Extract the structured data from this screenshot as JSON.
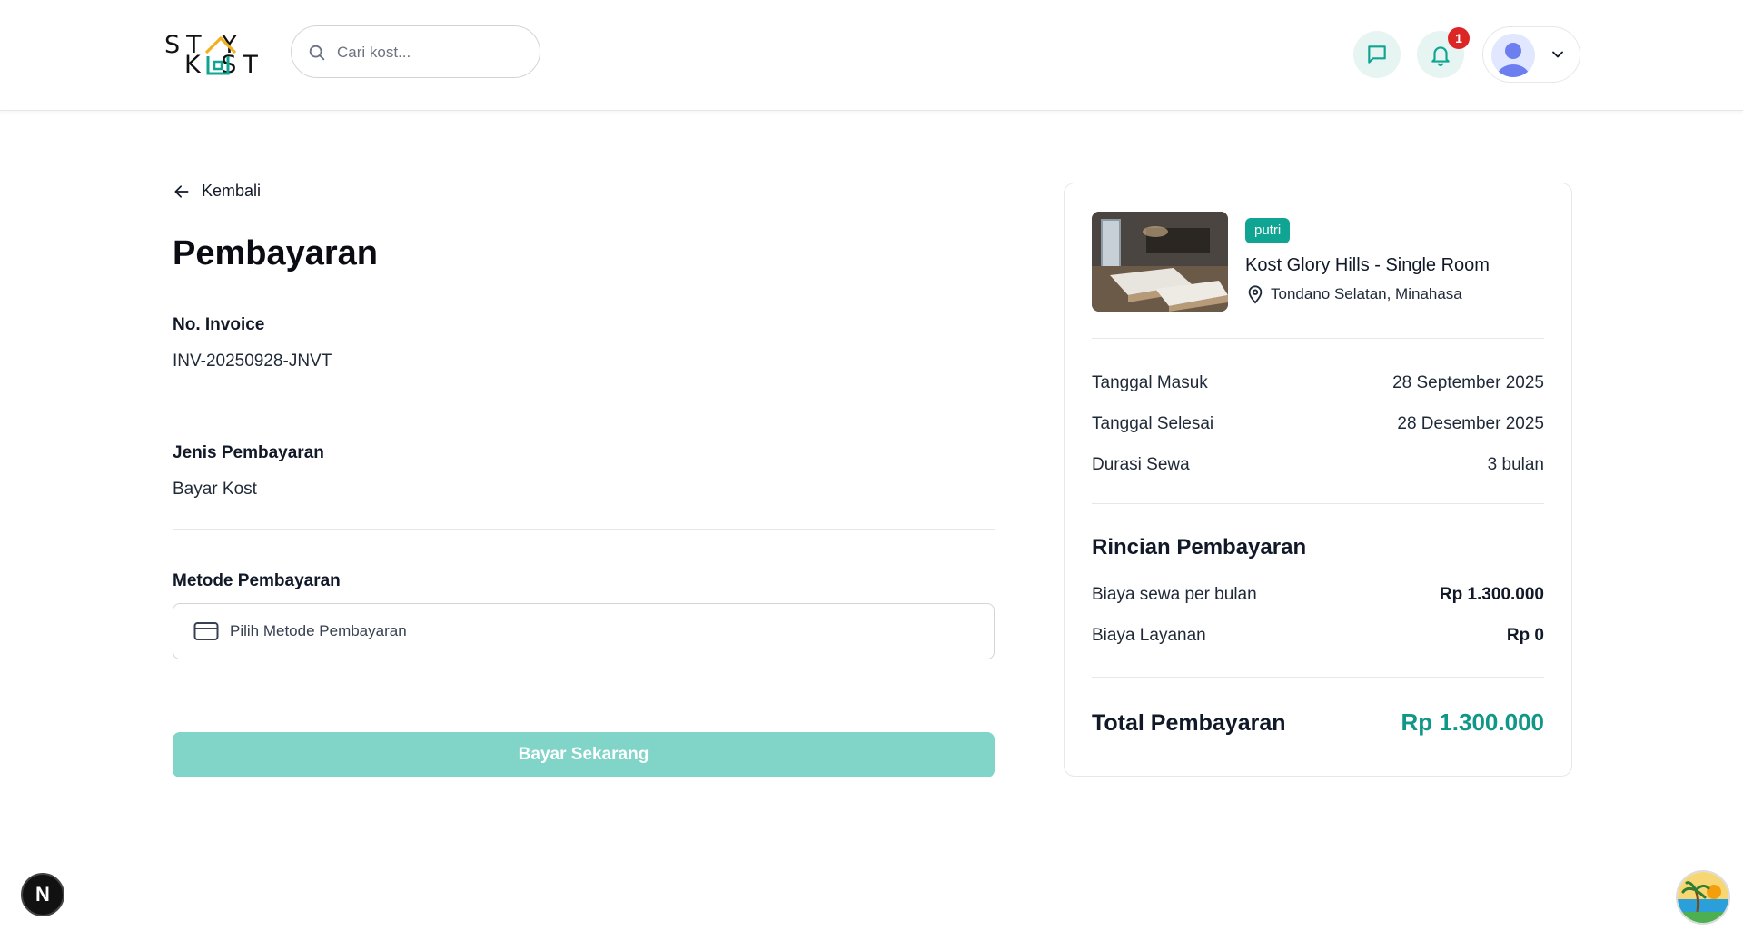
{
  "header": {
    "logo": {
      "line1": "ST Y",
      "line2": "K ST"
    },
    "search": {
      "placeholder": "Cari kost...",
      "value": ""
    },
    "notification_count": "1"
  },
  "main": {
    "back_label": "Kembali",
    "title": "Pembayaran",
    "invoice": {
      "label": "No. Invoice",
      "value": "INV-20250928-JNVT"
    },
    "payment_type": {
      "label": "Jenis Pembayaran",
      "value": "Bayar Kost"
    },
    "payment_method": {
      "label": "Metode Pembayaran",
      "placeholder": "Pilih Metode Pembayaran"
    },
    "pay_button": "Bayar Sekarang"
  },
  "summary": {
    "tag": "putri",
    "kost_name": "Kost Glory Hills - Single Room",
    "location": "Tondano Selatan, Minahasa",
    "rows": [
      {
        "label": "Tanggal Masuk",
        "value": "28 September 2025"
      },
      {
        "label": "Tanggal Selesai",
        "value": "28 Desember 2025"
      },
      {
        "label": "Durasi Sewa",
        "value": "3 bulan"
      }
    ],
    "details_title": "Rincian Pembayaran",
    "details": [
      {
        "label": "Biaya sewa per bulan",
        "value": "Rp 1.300.000"
      },
      {
        "label": "Biaya Layanan",
        "value": "Rp 0"
      }
    ],
    "total_label": "Total Pembayaran",
    "total_value": "Rp 1.300.000"
  },
  "floating": {
    "next_badge": "N"
  },
  "colors": {
    "accent": "#10a593",
    "accent_light": "#80d4c8",
    "total_text": "#109787",
    "badge": "#dc2626"
  }
}
